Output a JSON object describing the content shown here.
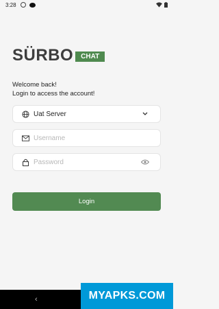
{
  "status_bar": {
    "time": "3:28"
  },
  "logo": {
    "word": "SÜRBO",
    "badge": "CHAT"
  },
  "welcome": {
    "line1": "Welcome back!",
    "line2": "Login to access the account!"
  },
  "server_select": {
    "value": "Uat Server",
    "icon": "globe-icon"
  },
  "username": {
    "placeholder": "Username",
    "icon": "envelope-icon"
  },
  "password": {
    "placeholder": "Password",
    "icon": "lock-icon"
  },
  "login_button": {
    "label": "Login"
  },
  "watermark": {
    "text": "MYAPKS.COM"
  },
  "nav": {
    "back": "‹"
  },
  "colors": {
    "accent": "#528a52",
    "background": "#f5f5f5",
    "watermark": "#0099d8"
  }
}
